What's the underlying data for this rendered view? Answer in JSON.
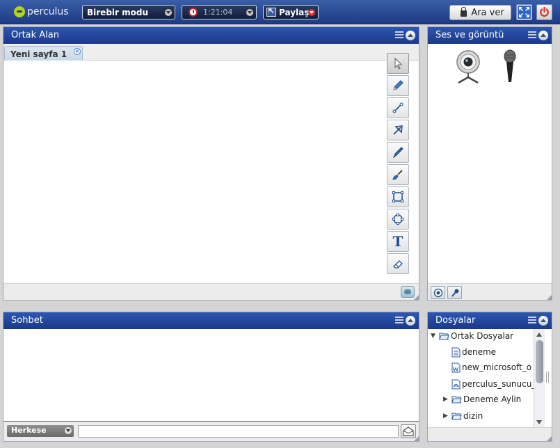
{
  "topbar": {
    "logo_text": "perculus",
    "mode": "Birebir modu",
    "timer": "1:21:04",
    "share_label": "Paylaş",
    "break_label": "Ara ver"
  },
  "whiteboard": {
    "title": "Ortak Alan",
    "tabs": [
      {
        "label": "Yeni sayfa 1"
      }
    ],
    "tools": [
      "select-icon",
      "pencil-icon",
      "line-icon",
      "pointer-arrow-icon",
      "pen-icon",
      "brush-icon",
      "rectangle-icon",
      "ellipse-icon",
      "text-icon",
      "eraser-icon"
    ],
    "text_tool_glyph": "T"
  },
  "av": {
    "title": "Ses ve görüntü"
  },
  "chat": {
    "title": "Sohbet",
    "audience": "Herkese",
    "input_value": ""
  },
  "files": {
    "title": "Dosyalar",
    "tree": [
      {
        "label": "Ortak Dosyalar",
        "type": "folder",
        "expanded": true
      },
      {
        "label": "deneme",
        "type": "text"
      },
      {
        "label": "new_microsoft_o",
        "type": "word"
      },
      {
        "label": "perculus_sunucu_",
        "type": "pdf"
      },
      {
        "label": "Deneme Aylin",
        "type": "folder",
        "expanded": false
      },
      {
        "label": "dizin",
        "type": "folder",
        "expanded": false
      }
    ]
  },
  "colors": {
    "topbar": "#1c3c84",
    "panel_header": "#2e56b1",
    "logo_accent": "#b9d31a",
    "power_red": "#d9302b",
    "clock_red": "#c8242a"
  }
}
